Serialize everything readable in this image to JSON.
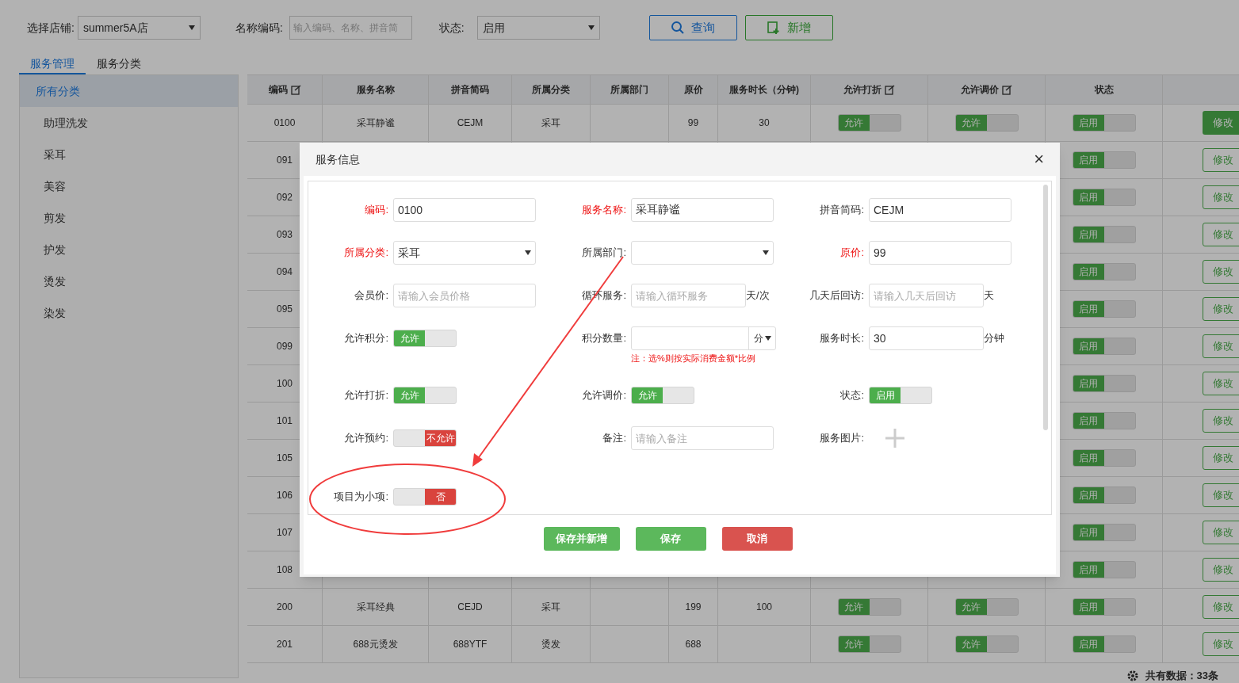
{
  "filters": {
    "store": {
      "label": "选择店铺:",
      "value": "summer5A店"
    },
    "name_code": {
      "label": "名称编码:",
      "placeholder": "输入编码、名称、拼音简"
    },
    "status": {
      "label": "状态:",
      "value": "启用"
    },
    "buttons": [
      {
        "kind": "search",
        "label": "查询"
      },
      {
        "kind": "add",
        "label": "新增"
      }
    ]
  },
  "tabs": [
    {
      "label": "服务管理",
      "selected": true
    },
    {
      "label": "服务分类",
      "selected": false
    }
  ],
  "sidebar": {
    "items": [
      {
        "label": "所有分类",
        "selected": true
      },
      {
        "label": "助理洗发",
        "selected": false
      },
      {
        "label": "采耳",
        "selected": false
      },
      {
        "label": "美容",
        "selected": false
      },
      {
        "label": "剪发",
        "selected": false
      },
      {
        "label": "护发",
        "selected": false
      },
      {
        "label": "烫发",
        "selected": false
      },
      {
        "label": "染发",
        "selected": false
      }
    ]
  },
  "table": {
    "columns": [
      {
        "label": "编码",
        "icon": true
      },
      {
        "label": "服务名称",
        "icon": false
      },
      {
        "label": "拼音简码",
        "icon": false
      },
      {
        "label": "所属分类",
        "icon": false
      },
      {
        "label": "所属部门",
        "icon": false
      },
      {
        "label": "原价",
        "icon": false
      },
      {
        "label": "服务时长（分钟)",
        "icon": false
      },
      {
        "label": "允许打折",
        "icon": true
      },
      {
        "label": "允许调价",
        "icon": true
      },
      {
        "label": "状态",
        "icon": false
      }
    ],
    "rows": [
      {
        "code": "0100",
        "name": "采耳静谧",
        "pinyin": "CEJM",
        "category": "采耳",
        "price": "99",
        "duration": "30",
        "discount": {
          "label": "允许",
          "on": true
        },
        "adjust": {
          "label": "允许",
          "on": true
        },
        "status": {
          "label": "启用",
          "on": true
        },
        "action": {
          "label": "修改",
          "selected": true
        }
      },
      {
        "code": "091",
        "status": {
          "label": "启用",
          "on": true
        },
        "action": {
          "label": "修改",
          "selected": false
        }
      },
      {
        "code": "092",
        "status": {
          "label": "启用",
          "on": true
        },
        "action": {
          "label": "修改",
          "selected": false
        }
      },
      {
        "code": "093",
        "status": {
          "label": "启用",
          "on": true
        },
        "action": {
          "label": "修改",
          "selected": false
        }
      },
      {
        "code": "094",
        "status": {
          "label": "启用",
          "on": true
        },
        "action": {
          "label": "修改",
          "selected": false
        }
      },
      {
        "code": "095",
        "status": {
          "label": "启用",
          "on": true
        },
        "action": {
          "label": "修改",
          "selected": false
        }
      },
      {
        "code": "099",
        "status": {
          "label": "启用",
          "on": true
        },
        "action": {
          "label": "修改",
          "selected": false
        }
      },
      {
        "code": "100",
        "status": {
          "label": "启用",
          "on": true
        },
        "action": {
          "label": "修改",
          "selected": false
        }
      },
      {
        "code": "101",
        "status": {
          "label": "启用",
          "on": true
        },
        "action": {
          "label": "修改",
          "selected": false
        }
      },
      {
        "code": "105",
        "status": {
          "label": "启用",
          "on": true
        },
        "action": {
          "label": "修改",
          "selected": false
        }
      },
      {
        "code": "106",
        "status": {
          "label": "启用",
          "on": true
        },
        "action": {
          "label": "修改",
          "selected": false
        }
      },
      {
        "code": "107",
        "status": {
          "label": "启用",
          "on": true
        },
        "action": {
          "label": "修改",
          "selected": false
        }
      },
      {
        "code": "108",
        "status": {
          "label": "启用",
          "on": true
        },
        "action": {
          "label": "修改",
          "selected": false
        }
      },
      {
        "code": "200",
        "name": "采耳经典",
        "pinyin": "CEJD",
        "category": "采耳",
        "price": "199",
        "duration": "100",
        "discount": {
          "label": "允许",
          "on": true
        },
        "adjust": {
          "label": "允许",
          "on": true
        },
        "status": {
          "label": "启用",
          "on": true
        },
        "action": {
          "label": "修改",
          "selected": false
        }
      },
      {
        "code": "201",
        "name": "688元烫发",
        "pinyin": "688YTF",
        "category": "烫发",
        "price": "688",
        "discount": {
          "label": "允许",
          "on": true
        },
        "adjust": {
          "label": "允许",
          "on": true
        },
        "status": {
          "label": "启用",
          "on": true
        },
        "action": {
          "label": "修改",
          "selected": false
        }
      }
    ]
  },
  "footer": {
    "total": "共有数据：33条"
  },
  "dialog": {
    "title": "服务信息",
    "close": "×",
    "rows": [
      [
        {
          "label": "编码:",
          "required": true,
          "kind": "input",
          "value": "0100"
        },
        {
          "label": "服务名称:",
          "required": true,
          "kind": "input",
          "value": "采耳静谧"
        },
        {
          "label": "拼音简码:",
          "required": false,
          "kind": "input",
          "value": "CEJM"
        }
      ],
      [
        {
          "label": "所属分类:",
          "required": true,
          "kind": "select",
          "value": "采耳"
        },
        {
          "label": "所属部门:",
          "required": false,
          "kind": "select"
        },
        {
          "label": "原价:",
          "required": true,
          "kind": "input",
          "value": "99"
        }
      ],
      [
        {
          "label": "会员价:",
          "required": false,
          "kind": "input",
          "placeholder": "请输入会员价格"
        },
        {
          "label": "循环服务:",
          "required": false,
          "kind": "input",
          "placeholder": "请输入循环服务",
          "unit": "天/次"
        },
        {
          "label": "几天后回访:",
          "required": false,
          "kind": "input",
          "placeholder": "请输入几天后回访",
          "unit": "天"
        }
      ],
      [
        {
          "label": "允许积分:",
          "required": false,
          "kind": "toggle",
          "text": "允许",
          "on": true
        },
        {
          "label": "积分数量:",
          "required": false,
          "kind": "points",
          "unit": "分",
          "note": "注：选%则按实际消费金额*比例"
        },
        {
          "label": "服务时长:",
          "required": false,
          "kind": "input",
          "value": "30",
          "unit": "分钟"
        }
      ],
      [
        {
          "label": "允许打折:",
          "required": false,
          "kind": "toggle",
          "text": "允许",
          "on": true
        },
        {
          "label": "允许调价:",
          "required": false,
          "kind": "toggle",
          "text": "允许",
          "on": true
        },
        {
          "label": "状态:",
          "required": false,
          "kind": "toggle",
          "text": "启用",
          "on": true
        }
      ],
      [
        {
          "label": "允许预约:",
          "required": false,
          "kind": "toggle",
          "text": "不允许",
          "on": false
        },
        {
          "label": "备注:",
          "required": false,
          "kind": "input",
          "placeholder": "请输入备注"
        },
        {
          "label": "服务图片:",
          "required": false,
          "kind": "upload"
        }
      ],
      [
        {
          "label": "项目为小项:",
          "required": false,
          "kind": "toggle",
          "text": "否",
          "on": false
        }
      ]
    ],
    "buttons": [
      {
        "kind": "save_new",
        "label": "保存并新增"
      },
      {
        "kind": "save",
        "label": "保存"
      },
      {
        "kind": "cancel",
        "label": "取消"
      }
    ]
  }
}
